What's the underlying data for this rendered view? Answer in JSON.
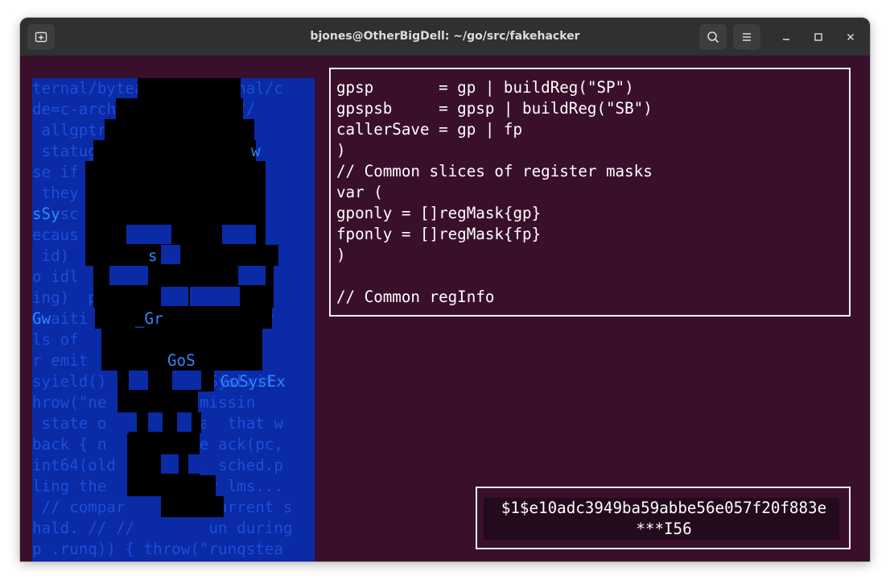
{
  "window": {
    "title": "bjones@OtherBigDell: ~/go/src/fakehacker",
    "colors": {
      "titlebar": "#303030",
      "terminal_bg": "#3a0f2c",
      "panel_blue": "#0a2aa6",
      "text": "#ffffff"
    }
  },
  "titlebar_icons": {
    "new_tab": "new-tab-icon",
    "search": "search-icon",
    "menu": "hamburger-menu-icon",
    "minimize": "minimize-icon",
    "maximize": "maximize-icon",
    "close": "close-icon"
  },
  "skull_panel": {
    "background_lines": [
      "ternal/bytealg\" \"internal/c",
      "de=c-archi     shared //",
      " allgptr         variabl",
      " statug          waitin",
      "se if             s is",
      " they              //go",
      "sSysc              ad(&",
      "ecaus              abo",
      " id)   oes    =    !=",
      "o idl  whil  heck  d fi",
      "ing)  procs  omic  ad(&",
      "Gwaiti   _Gr n able  if tr",
      "ls of               swri",
      "r emit    GoS     k; //",
      "syield() }  tra  GoSysExit",
      "hrow(\"ne pr    W  missin",
      " state o  t e t r a  that w",
      "back { n   gentrace ack(pc,",
      "int64(old    (now - sched.p",
      "ling the    e   f  r lms...",
      " // compar          urrent s",
      "hald. // //        un during",
      "p .runq)) { throw(\"runqstea"
    ],
    "highlighted_words": [
      "Gw",
      "_Gr",
      "GoS",
      "GoSysEx",
      "sSy",
      "s",
      "w"
    ]
  },
  "code_panel": {
    "lines": [
      "gpsp       = gp | buildReg(\"SP\")",
      "gpspsb     = gpsp | buildReg(\"SB\")",
      "callerSave = gp | fp",
      ")",
      "// Common slices of register masks",
      "var (",
      "gponly = []regMask{gp}",
      "fponly = []regMask{fp}",
      ")",
      "",
      "// Common regInfo"
    ]
  },
  "hash_panel": {
    "line1": "$1$e10adc3949ba59abbe56e057f20f883e",
    "line2": "***I56"
  }
}
